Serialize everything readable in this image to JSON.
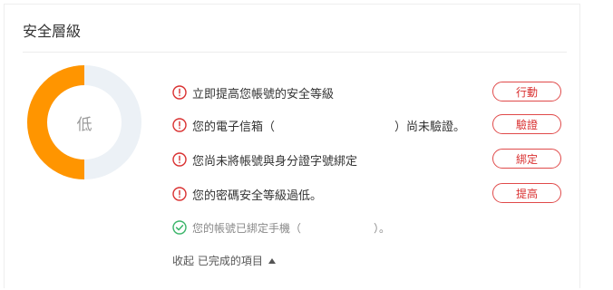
{
  "panel": {
    "title": "安全層級"
  },
  "security_level": {
    "label": "低",
    "progress_fraction": 0.5,
    "accent_color": "#ff9500",
    "track_color": "#ecf1f6"
  },
  "items": [
    {
      "text": "立即提高您帳號的安全等級",
      "closing": "",
      "button": "行動"
    },
    {
      "text": "您的電子信箱（",
      "closing": "）尚未驗證。",
      "button": "驗證"
    },
    {
      "text": "您尚未將帳號與身分證字號綁定",
      "closing": "",
      "button": "綁定"
    },
    {
      "text": "您的密碼安全等級過低。",
      "closing": "",
      "button": "提高"
    }
  ],
  "completed": [
    {
      "text": "您的帳號已綁定手機（",
      "closing": "）。"
    }
  ],
  "collapse_label": "收起 已完成的項目",
  "colors": {
    "warning": "#d93030",
    "success": "#3bb56a"
  }
}
